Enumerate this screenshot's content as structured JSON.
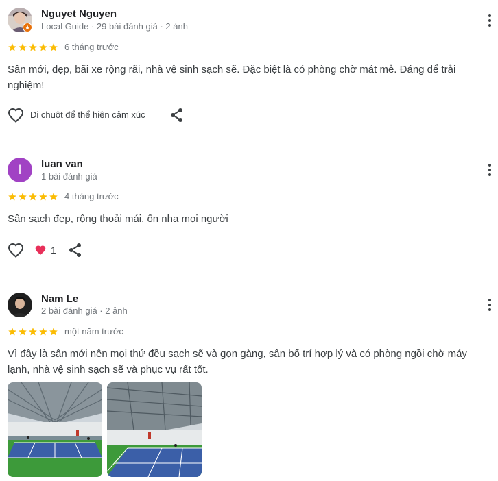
{
  "reviews": [
    {
      "name": "Nguyet Nguyen",
      "meta": "Local Guide · 29 bài đánh giá · 2 ảnh",
      "rating": 5,
      "time": "6 tháng trước",
      "text": "Sân mới, đẹp, bãi xe rộng rãi, nhà vệ sinh sạch sẽ. Đặc biệt là có phòng chờ mát mẻ. Đáng để trải nghiệm!",
      "reaction_hint": "Di chuột để thể hiện cảm xúc"
    },
    {
      "name": "luan van",
      "avatar_letter": "l",
      "meta": "1 bài đánh giá",
      "rating": 5,
      "time": "4 tháng trước",
      "text": "Sân sạch đẹp, rộng thoải mái, ổn nha mọi người",
      "like_count": "1"
    },
    {
      "name": "Nam Le",
      "meta": "2 bài đánh giá · 2 ảnh",
      "rating": 5,
      "time": "một năm trước",
      "text": "Vì đây là sân mới nên mọi thứ đều sạch sẽ và gọn gàng, sân bố trí hợp lý và có phòng ngồi chờ máy lạnh, nhà vệ sinh sạch sẽ và phục vụ rất tốt.",
      "photo_count": 2
    }
  ],
  "colors": {
    "star": "#fbbc04",
    "letter_avatar": "#a142c4",
    "heart": "#e8305a",
    "court": "#3b5fa8",
    "turf": "#3d9a3a"
  },
  "icons": [
    "local-guide-badge-icon",
    "more-vert-icon",
    "star-icon",
    "heart-outline-icon",
    "heart-filled-icon",
    "share-icon"
  ]
}
